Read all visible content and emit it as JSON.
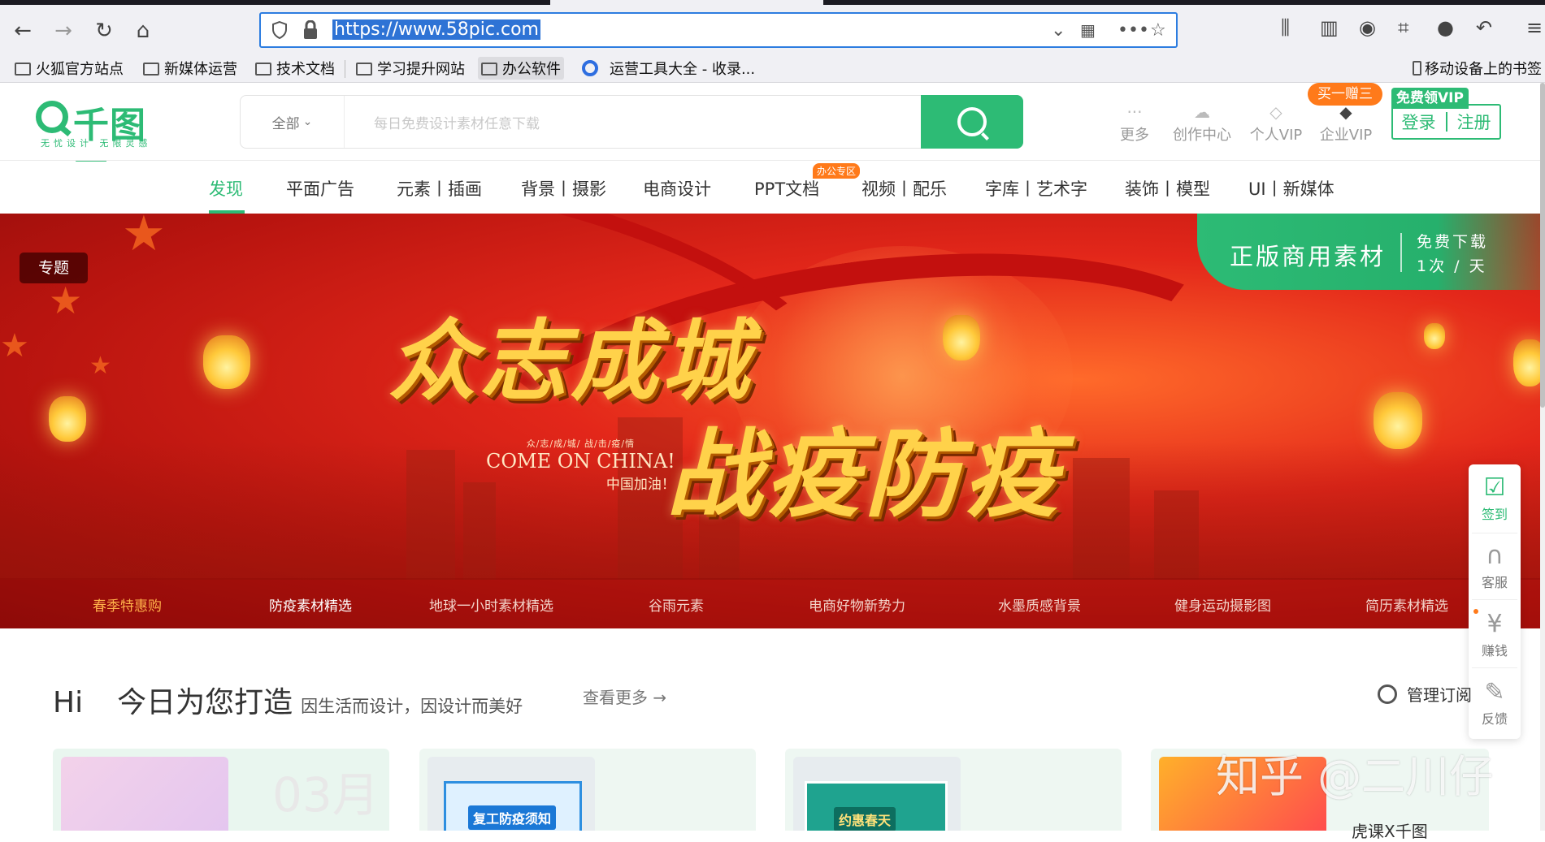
{
  "browser": {
    "url": "https://www.58pic.com",
    "bookmarks": [
      "火狐官方站点",
      "新媒体运营",
      "技术文档",
      "学习提升网站",
      "办公软件",
      "运营工具大全 - 收录...",
      "移动设备上的书签"
    ]
  },
  "header": {
    "logo_name": "千图网",
    "logo_tag": "无忧设计 无限灵感",
    "search_category": "全部",
    "search_placeholder": "每日免费设计素材任意下载",
    "nav": [
      {
        "label": "更多",
        "icon": "more-dots-icon"
      },
      {
        "label": "创作中心",
        "icon": "upload-cloud-icon"
      },
      {
        "label": "个人VIP",
        "icon": "diamond-icon"
      },
      {
        "label": "企业VIP",
        "icon": "enterprise-diamond-icon"
      }
    ],
    "promo_pill": "买一赠三",
    "vip_tag": "免费领VIP",
    "login": "登录",
    "register": "注册"
  },
  "categories": [
    "发现",
    "平面广告",
    "元素丨插画",
    "背景丨摄影",
    "电商设计",
    "PPT文档",
    "视频丨配乐",
    "字库丨艺术字",
    "装饰丨模型",
    "UI丨新媒体"
  ],
  "office_badge": "办公专区",
  "banner": {
    "topic_tag": "专题",
    "licence_main": "正版商用素材",
    "licence_free": "免费下载",
    "licence_rate": "1次 / 天",
    "headline1": "众志成城",
    "headline2": "战疫防疫",
    "cheer_small": "众/志/成/城/   战/击/疫/情",
    "cheer_en": "COME ON CHINA!",
    "cheer_zh": "中国加油！",
    "links": [
      "春季特惠购",
      "防疫素材精选",
      "地球一小时素材精选",
      "谷雨元素",
      "电商好物新势力",
      "水墨质感背景",
      "健身运动摄影图",
      "简历素材精选"
    ]
  },
  "side_tools": [
    "签到",
    "客服",
    "赚钱",
    "反馈"
  ],
  "recommend": {
    "hi": "Hi",
    "title": "今日为您打造",
    "subtitle": "因生活而设计，因设计而美好",
    "more": "查看更多 →",
    "manage": "管理订阅",
    "card1_month": "03月",
    "card2_poster": "复工防疫须知",
    "card3_poster": "约惠春天",
    "card4_label": "虎课X千图"
  },
  "watermark": "知乎 @二川仔"
}
